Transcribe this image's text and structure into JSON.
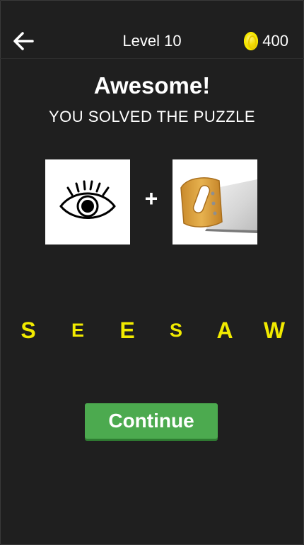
{
  "header": {
    "back_icon": "arrow-left-icon",
    "level_label": "Level 10",
    "coin_icon": "coin-icon",
    "coins": "400"
  },
  "result": {
    "title": "Awesome!",
    "subtitle": "YOU SOLVED THE PUZZLE"
  },
  "clues": {
    "first_icon": "eye-icon",
    "operator": "+",
    "second_icon": "saw-icon"
  },
  "answer": {
    "letters": [
      "S",
      "E",
      "E",
      "S",
      "A",
      "W"
    ]
  },
  "actions": {
    "continue_label": "Continue"
  },
  "colors": {
    "background": "#1f1f1f",
    "answer_letter": "#f1ea00",
    "continue_button": "#4caa4f"
  }
}
